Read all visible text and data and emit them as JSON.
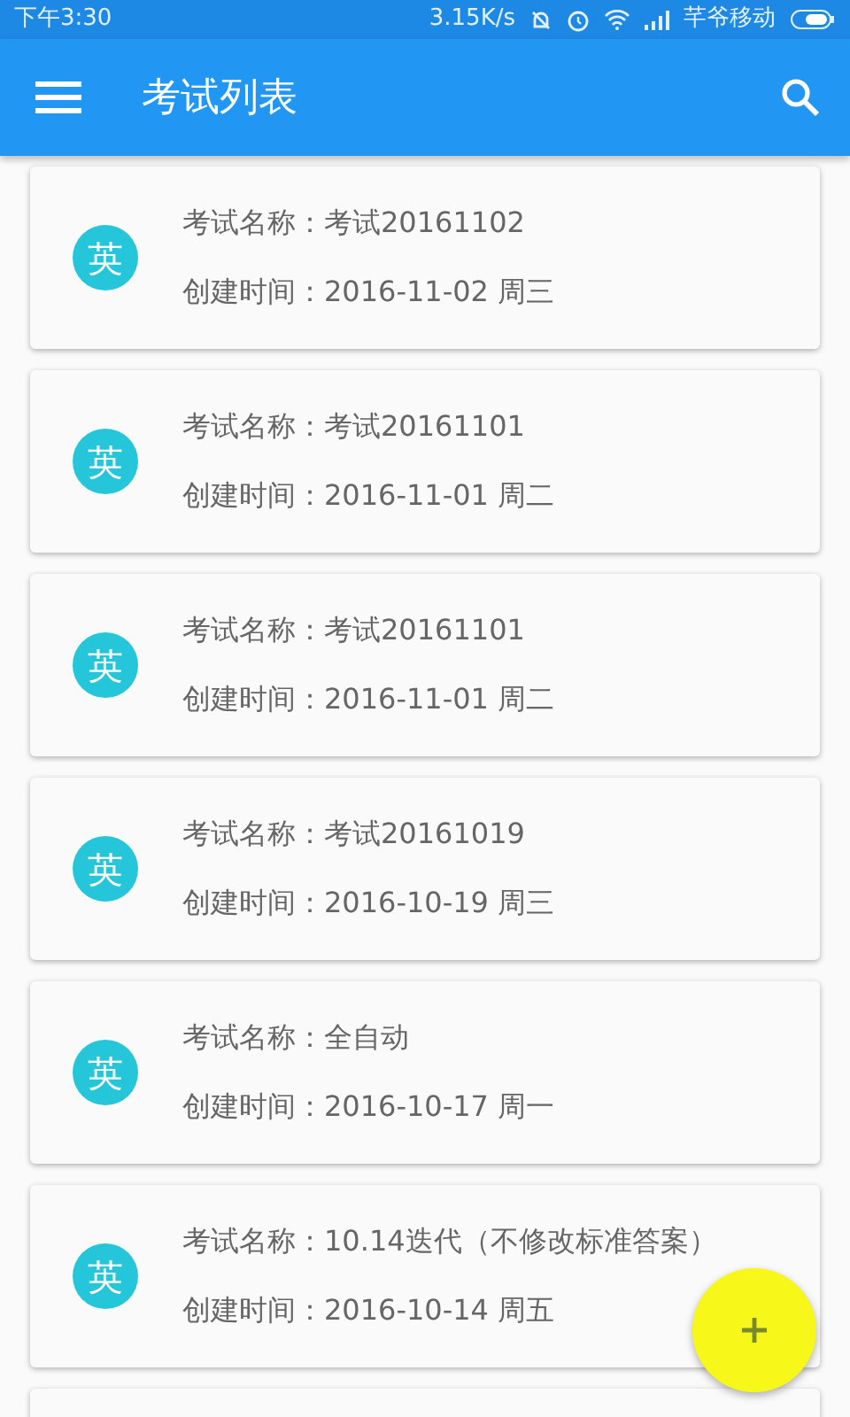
{
  "status_bar": {
    "time": "下午3:30",
    "speed": "3.15K/s",
    "carrier": "芊爷移动"
  },
  "toolbar": {
    "title": "考试列表"
  },
  "exams": [
    {
      "avatar": "英",
      "name": "考试名称：考试20161102",
      "created": "创建时间：2016-11-02 周三"
    },
    {
      "avatar": "英",
      "name": "考试名称：考试20161101",
      "created": "创建时间：2016-11-01 周二"
    },
    {
      "avatar": "英",
      "name": "考试名称：考试20161101",
      "created": "创建时间：2016-11-01 周二"
    },
    {
      "avatar": "英",
      "name": "考试名称：考试20161019",
      "created": "创建时间：2016-10-19 周三"
    },
    {
      "avatar": "英",
      "name": "考试名称：全自动",
      "created": "创建时间：2016-10-17 周一"
    },
    {
      "avatar": "英",
      "name": "考试名称：10.14迭代（不修改标准答案）",
      "created": "创建时间：2016-10-14 周五"
    }
  ]
}
